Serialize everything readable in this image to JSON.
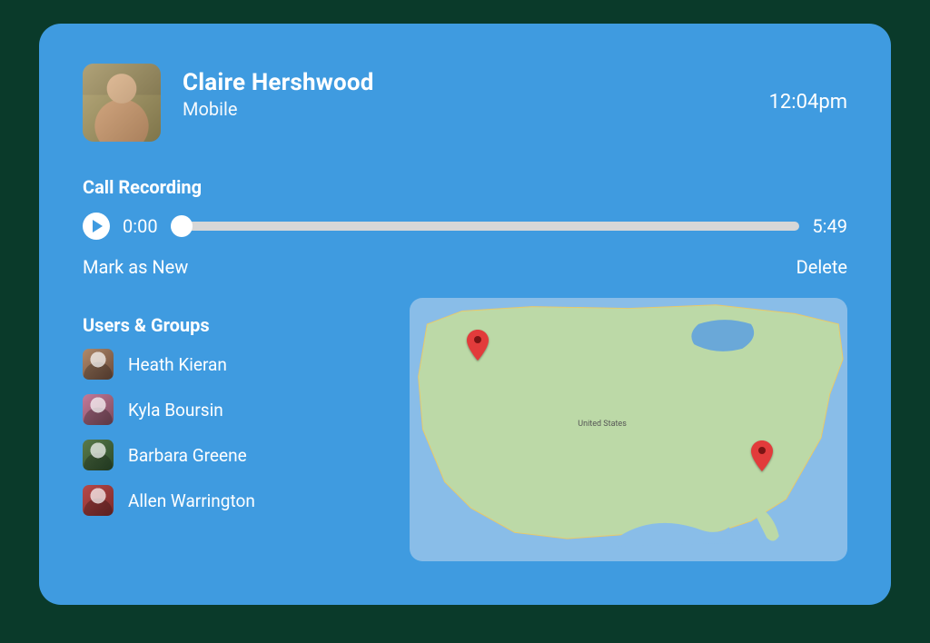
{
  "contact": {
    "name": "Claire Hershwood",
    "subtitle": "Mobile",
    "time": "12:04pm"
  },
  "recording": {
    "title": "Call Recording",
    "current": "0:00",
    "duration": "5:49",
    "mark_new": "Mark as New",
    "delete": "Delete"
  },
  "users": {
    "title": "Users & Groups",
    "items": [
      {
        "name": "Heath Kieran"
      },
      {
        "name": "Kyla Boursin"
      },
      {
        "name": "Barbara Greene"
      },
      {
        "name": "Allen Warrington"
      }
    ]
  },
  "map": {
    "label_country": "United States",
    "pins": [
      {
        "name": "pin-northwest"
      },
      {
        "name": "pin-southeast"
      }
    ]
  }
}
